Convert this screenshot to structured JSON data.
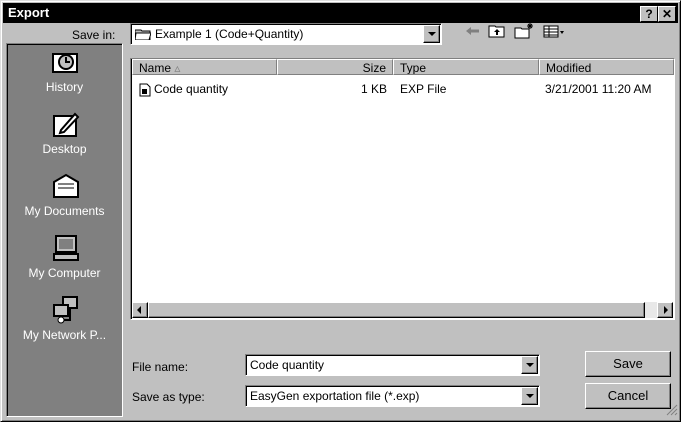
{
  "window": {
    "title": "Export",
    "help_label": "?",
    "close_label": "✕"
  },
  "save_in": {
    "label": "Save in:",
    "value": "Example 1 (Code+Quantity)"
  },
  "toolbar": {
    "back_icon": "back-arrow-icon",
    "up_icon": "up-folder-icon",
    "new_folder_icon": "new-folder-icon",
    "view_menu_icon": "view-menu-icon"
  },
  "places": [
    {
      "label": "History",
      "icon": "history-icon"
    },
    {
      "label": "Desktop",
      "icon": "desktop-icon"
    },
    {
      "label": "My Documents",
      "icon": "my-documents-icon"
    },
    {
      "label": "My Computer",
      "icon": "my-computer-icon"
    },
    {
      "label": "My Network P...",
      "icon": "my-network-places-icon"
    }
  ],
  "columns": {
    "name": "Name",
    "size": "Size",
    "type": "Type",
    "modified": "Modified"
  },
  "files": [
    {
      "name": "Code quantity",
      "size": "1 KB",
      "type": "EXP File",
      "modified": "3/21/2001 11:20 AM"
    }
  ],
  "file_name": {
    "label": "File name:",
    "value": "Code quantity"
  },
  "save_as_type": {
    "label": "Save as type:",
    "value": "EasyGen exportation file (*.exp)"
  },
  "buttons": {
    "save": "Save",
    "cancel": "Cancel"
  }
}
